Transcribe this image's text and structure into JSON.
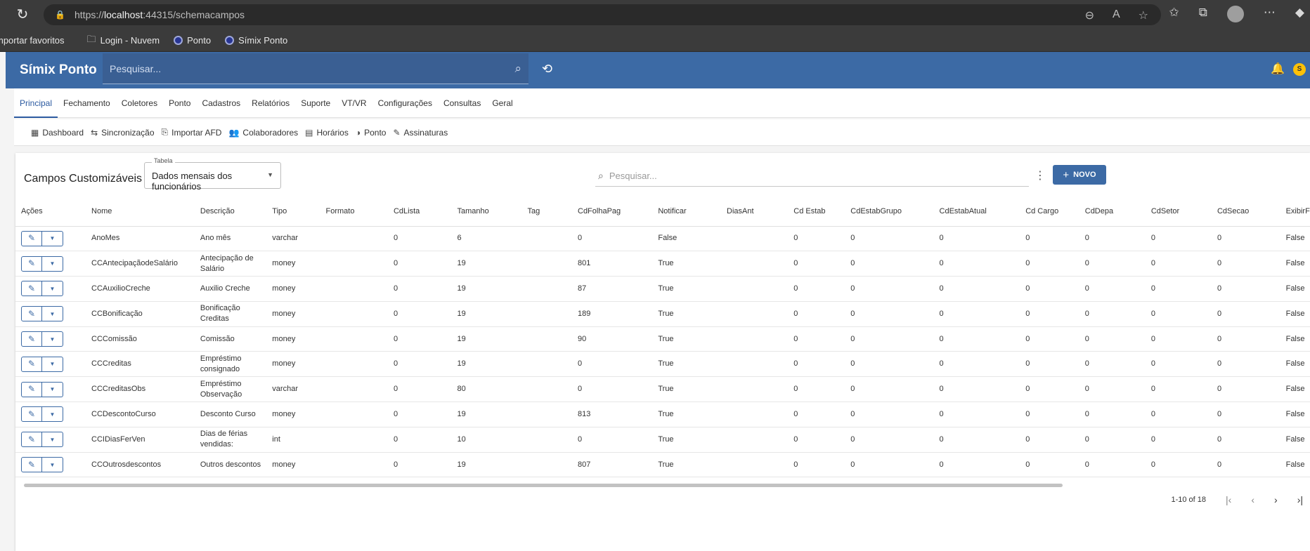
{
  "browser": {
    "url_scheme": "https://",
    "url_host": "localhost",
    "url_rest": ":44315/schemacampos",
    "bookmarks": [
      "mportar favoritos",
      "Login - Nuvem",
      "Ponto",
      "Símix Ponto"
    ]
  },
  "app": {
    "brand": "Símix Ponto",
    "search_placeholder": "Pesquisar...",
    "user_initial": "S"
  },
  "menu": [
    "Principal",
    "Fechamento",
    "Coletores",
    "Ponto",
    "Cadastros",
    "Relatórios",
    "Suporte",
    "VT/VR",
    "Configurações",
    "Consultas",
    "Geral"
  ],
  "submenu": [
    {
      "icon": "dashboard-icon",
      "glyph": "▦",
      "label": "Dashboard"
    },
    {
      "icon": "sync-icon",
      "glyph": "⇆",
      "label": "Sincronização"
    },
    {
      "icon": "import-icon",
      "glyph": "⎘",
      "label": "Importar AFD"
    },
    {
      "icon": "people-icon",
      "glyph": "👥",
      "label": "Colaboradores"
    },
    {
      "icon": "calendar-icon",
      "glyph": "▤",
      "label": "Horários"
    },
    {
      "icon": "clock-icon",
      "glyph": "◑",
      "label": "Ponto"
    },
    {
      "icon": "signature-icon",
      "glyph": "✎",
      "label": "Assinaturas"
    }
  ],
  "card": {
    "title": "Campos Customizáveis",
    "tabela_label": "Tabela",
    "tabela_value": "Dados mensais dos funcionários",
    "search_placeholder": "Pesquisar...",
    "novo_label": "NOVO"
  },
  "table": {
    "headers": [
      "Ações",
      "Nome",
      "Descrição",
      "Tipo",
      "Formato",
      "CdLista",
      "Tamanho",
      "Tag",
      "CdFolhaPag",
      "Notificar",
      "DiasAnt",
      "Cd Estab",
      "CdEstabGrupo",
      "CdEstabAtual",
      "Cd Cargo",
      "CdDepa",
      "CdSetor",
      "CdSecao",
      "ExibirF"
    ],
    "rows": [
      [
        "AnoMes",
        "Ano mês",
        "varchar",
        "",
        "0",
        "6",
        "",
        "0",
        "False",
        "",
        "0",
        "0",
        "0",
        "0",
        "0",
        "0",
        "0",
        "False"
      ],
      [
        "CCAntecipaçãodeSalário",
        "Antecipação de Salário",
        "money",
        "",
        "0",
        "19",
        "",
        "801",
        "True",
        "",
        "0",
        "0",
        "0",
        "0",
        "0",
        "0",
        "0",
        "False"
      ],
      [
        "CCAuxilioCreche",
        "Auxilio Creche",
        "money",
        "",
        "0",
        "19",
        "",
        "87",
        "True",
        "",
        "0",
        "0",
        "0",
        "0",
        "0",
        "0",
        "0",
        "False"
      ],
      [
        "CCBonificação",
        "Bonificação Creditas",
        "money",
        "",
        "0",
        "19",
        "",
        "189",
        "True",
        "",
        "0",
        "0",
        "0",
        "0",
        "0",
        "0",
        "0",
        "False"
      ],
      [
        "CCComissão",
        "Comissão",
        "money",
        "",
        "0",
        "19",
        "",
        "90",
        "True",
        "",
        "0",
        "0",
        "0",
        "0",
        "0",
        "0",
        "0",
        "False"
      ],
      [
        "CCCreditas",
        "Empréstimo consignado",
        "money",
        "",
        "0",
        "19",
        "",
        "0",
        "True",
        "",
        "0",
        "0",
        "0",
        "0",
        "0",
        "0",
        "0",
        "False"
      ],
      [
        "CCCreditasObs",
        "Empréstimo Observação",
        "varchar",
        "",
        "0",
        "80",
        "",
        "0",
        "True",
        "",
        "0",
        "0",
        "0",
        "0",
        "0",
        "0",
        "0",
        "False"
      ],
      [
        "CCDescontoCurso",
        "Desconto Curso",
        "money",
        "",
        "0",
        "19",
        "",
        "813",
        "True",
        "",
        "0",
        "0",
        "0",
        "0",
        "0",
        "0",
        "0",
        "False"
      ],
      [
        "CCIDiasFerVen",
        "Dias de férias vendidas:",
        "int",
        "",
        "0",
        "10",
        "",
        "0",
        "True",
        "",
        "0",
        "0",
        "0",
        "0",
        "0",
        "0",
        "0",
        "False"
      ],
      [
        "CCOutrosdescontos",
        "Outros descontos",
        "money",
        "",
        "0",
        "19",
        "",
        "807",
        "True",
        "",
        "0",
        "0",
        "0",
        "0",
        "0",
        "0",
        "0",
        "False"
      ]
    ]
  },
  "pagination": {
    "range": "1-10 of 18"
  }
}
